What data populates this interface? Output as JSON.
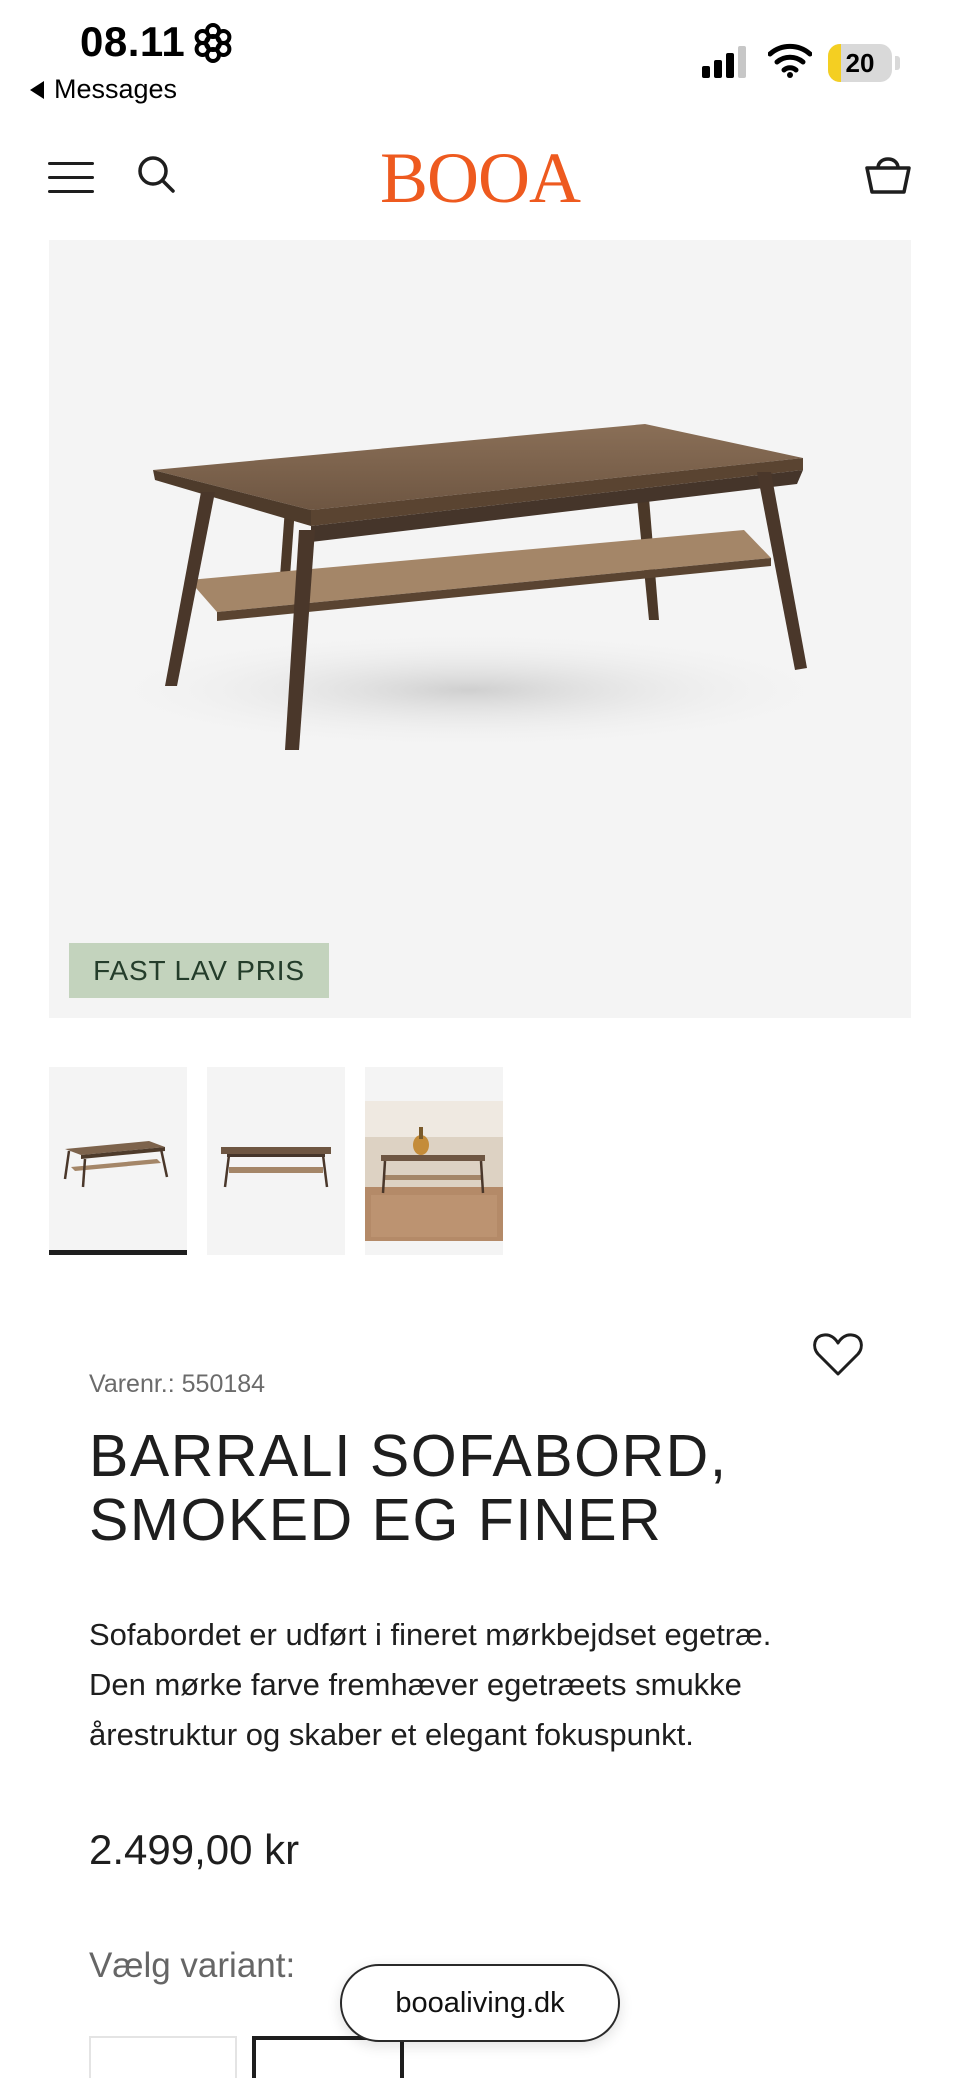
{
  "status_bar": {
    "time": "08.11",
    "back_label": "Messages",
    "battery_text": "20",
    "battery_level_percent": 20,
    "battery_color": "#f4cf22"
  },
  "header": {
    "brand": "BOOA",
    "brand_color": "#ee5a1f",
    "icons": [
      "menu-icon",
      "search-icon",
      "cart-icon"
    ]
  },
  "gallery": {
    "badge": "FAST LAV PRIS",
    "badge_bg": "#c3d3bd",
    "thumbnails": [
      "thumbnail-angled",
      "thumbnail-front",
      "thumbnail-room"
    ],
    "active_thumbnail": 0
  },
  "product": {
    "sku": "Varenr.: 550184",
    "title_line1": "BARRALI SOFABORD,",
    "title_line2": "SMOKED EG FINER",
    "description_lines": [
      "Sofabordet er udført i fineret mørkbejdset egetræ.",
      "Den mørke farve fremhæver egetræets smukke",
      "årestruktur og skaber et elegant fokuspunkt."
    ],
    "price": "2.499,00 kr",
    "variant_label": "Vælg variant:"
  },
  "browser": {
    "url": "booaliving.dk"
  }
}
